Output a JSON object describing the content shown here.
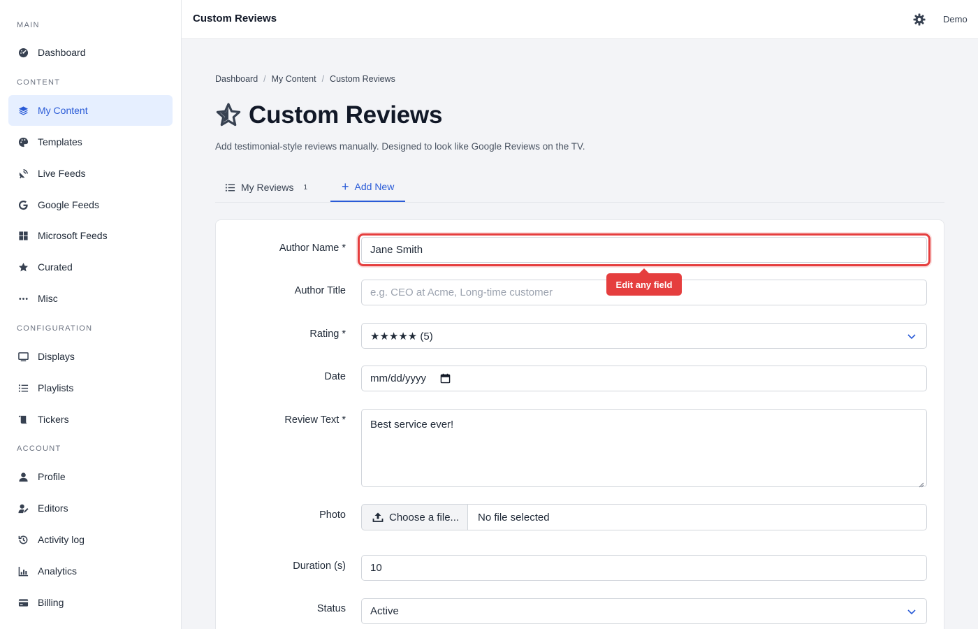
{
  "sidebar": {
    "sections": {
      "main": "MAIN",
      "content": "CONTENT",
      "configuration": "CONFIGURATION",
      "account": "ACCOUNT"
    },
    "items": {
      "dashboard": "Dashboard",
      "my_content": "My Content",
      "templates": "Templates",
      "live_feeds": "Live Feeds",
      "google_feeds": "Google Feeds",
      "microsoft_feeds": "Microsoft Feeds",
      "curated": "Curated",
      "misc": "Misc",
      "displays": "Displays",
      "playlists": "Playlists",
      "tickers": "Tickers",
      "profile": "Profile",
      "editors": "Editors",
      "activity_log": "Activity log",
      "analytics": "Analytics",
      "billing": "Billing"
    },
    "active_item": "my_content"
  },
  "topbar": {
    "title": "Custom Reviews",
    "user": "Demo",
    "icon": "gear-icon"
  },
  "breadcrumb": {
    "items": [
      "Dashboard",
      "My Content",
      "Custom Reviews"
    ],
    "separator": "/"
  },
  "page": {
    "title": "Custom Reviews",
    "icon": "star-icon",
    "subtitle": "Add testimonial-style reviews manually. Designed to look like Google Reviews on the TV."
  },
  "tabs": {
    "my_reviews": {
      "label": "My Reviews",
      "count": "1"
    },
    "add_new": {
      "label": "Add New",
      "prefix": "+"
    },
    "active": "add_new"
  },
  "form": {
    "author_name": {
      "label": "Author Name *",
      "value": "Jane Smith"
    },
    "author_title": {
      "label": "Author Title",
      "placeholder": "e.g. CEO at Acme, Long-time customer"
    },
    "rating": {
      "label": "Rating *",
      "value": "★★★★★ (5)"
    },
    "date": {
      "label": "Date",
      "value": "mm/dd/yyyy"
    },
    "review_text": {
      "label": "Review Text *",
      "value": "Best service ever!"
    },
    "photo": {
      "label": "Photo",
      "button": "Choose a file...",
      "file_name": "No file selected"
    },
    "duration": {
      "label": "Duration (s)",
      "value": "10"
    },
    "status": {
      "label": "Status",
      "value": "Active"
    }
  },
  "tooltip": {
    "text": "Edit any field"
  },
  "colors": {
    "accent": "#2a5bd7",
    "active_bg": "#e6efff",
    "highlight": "#e53e3e"
  }
}
